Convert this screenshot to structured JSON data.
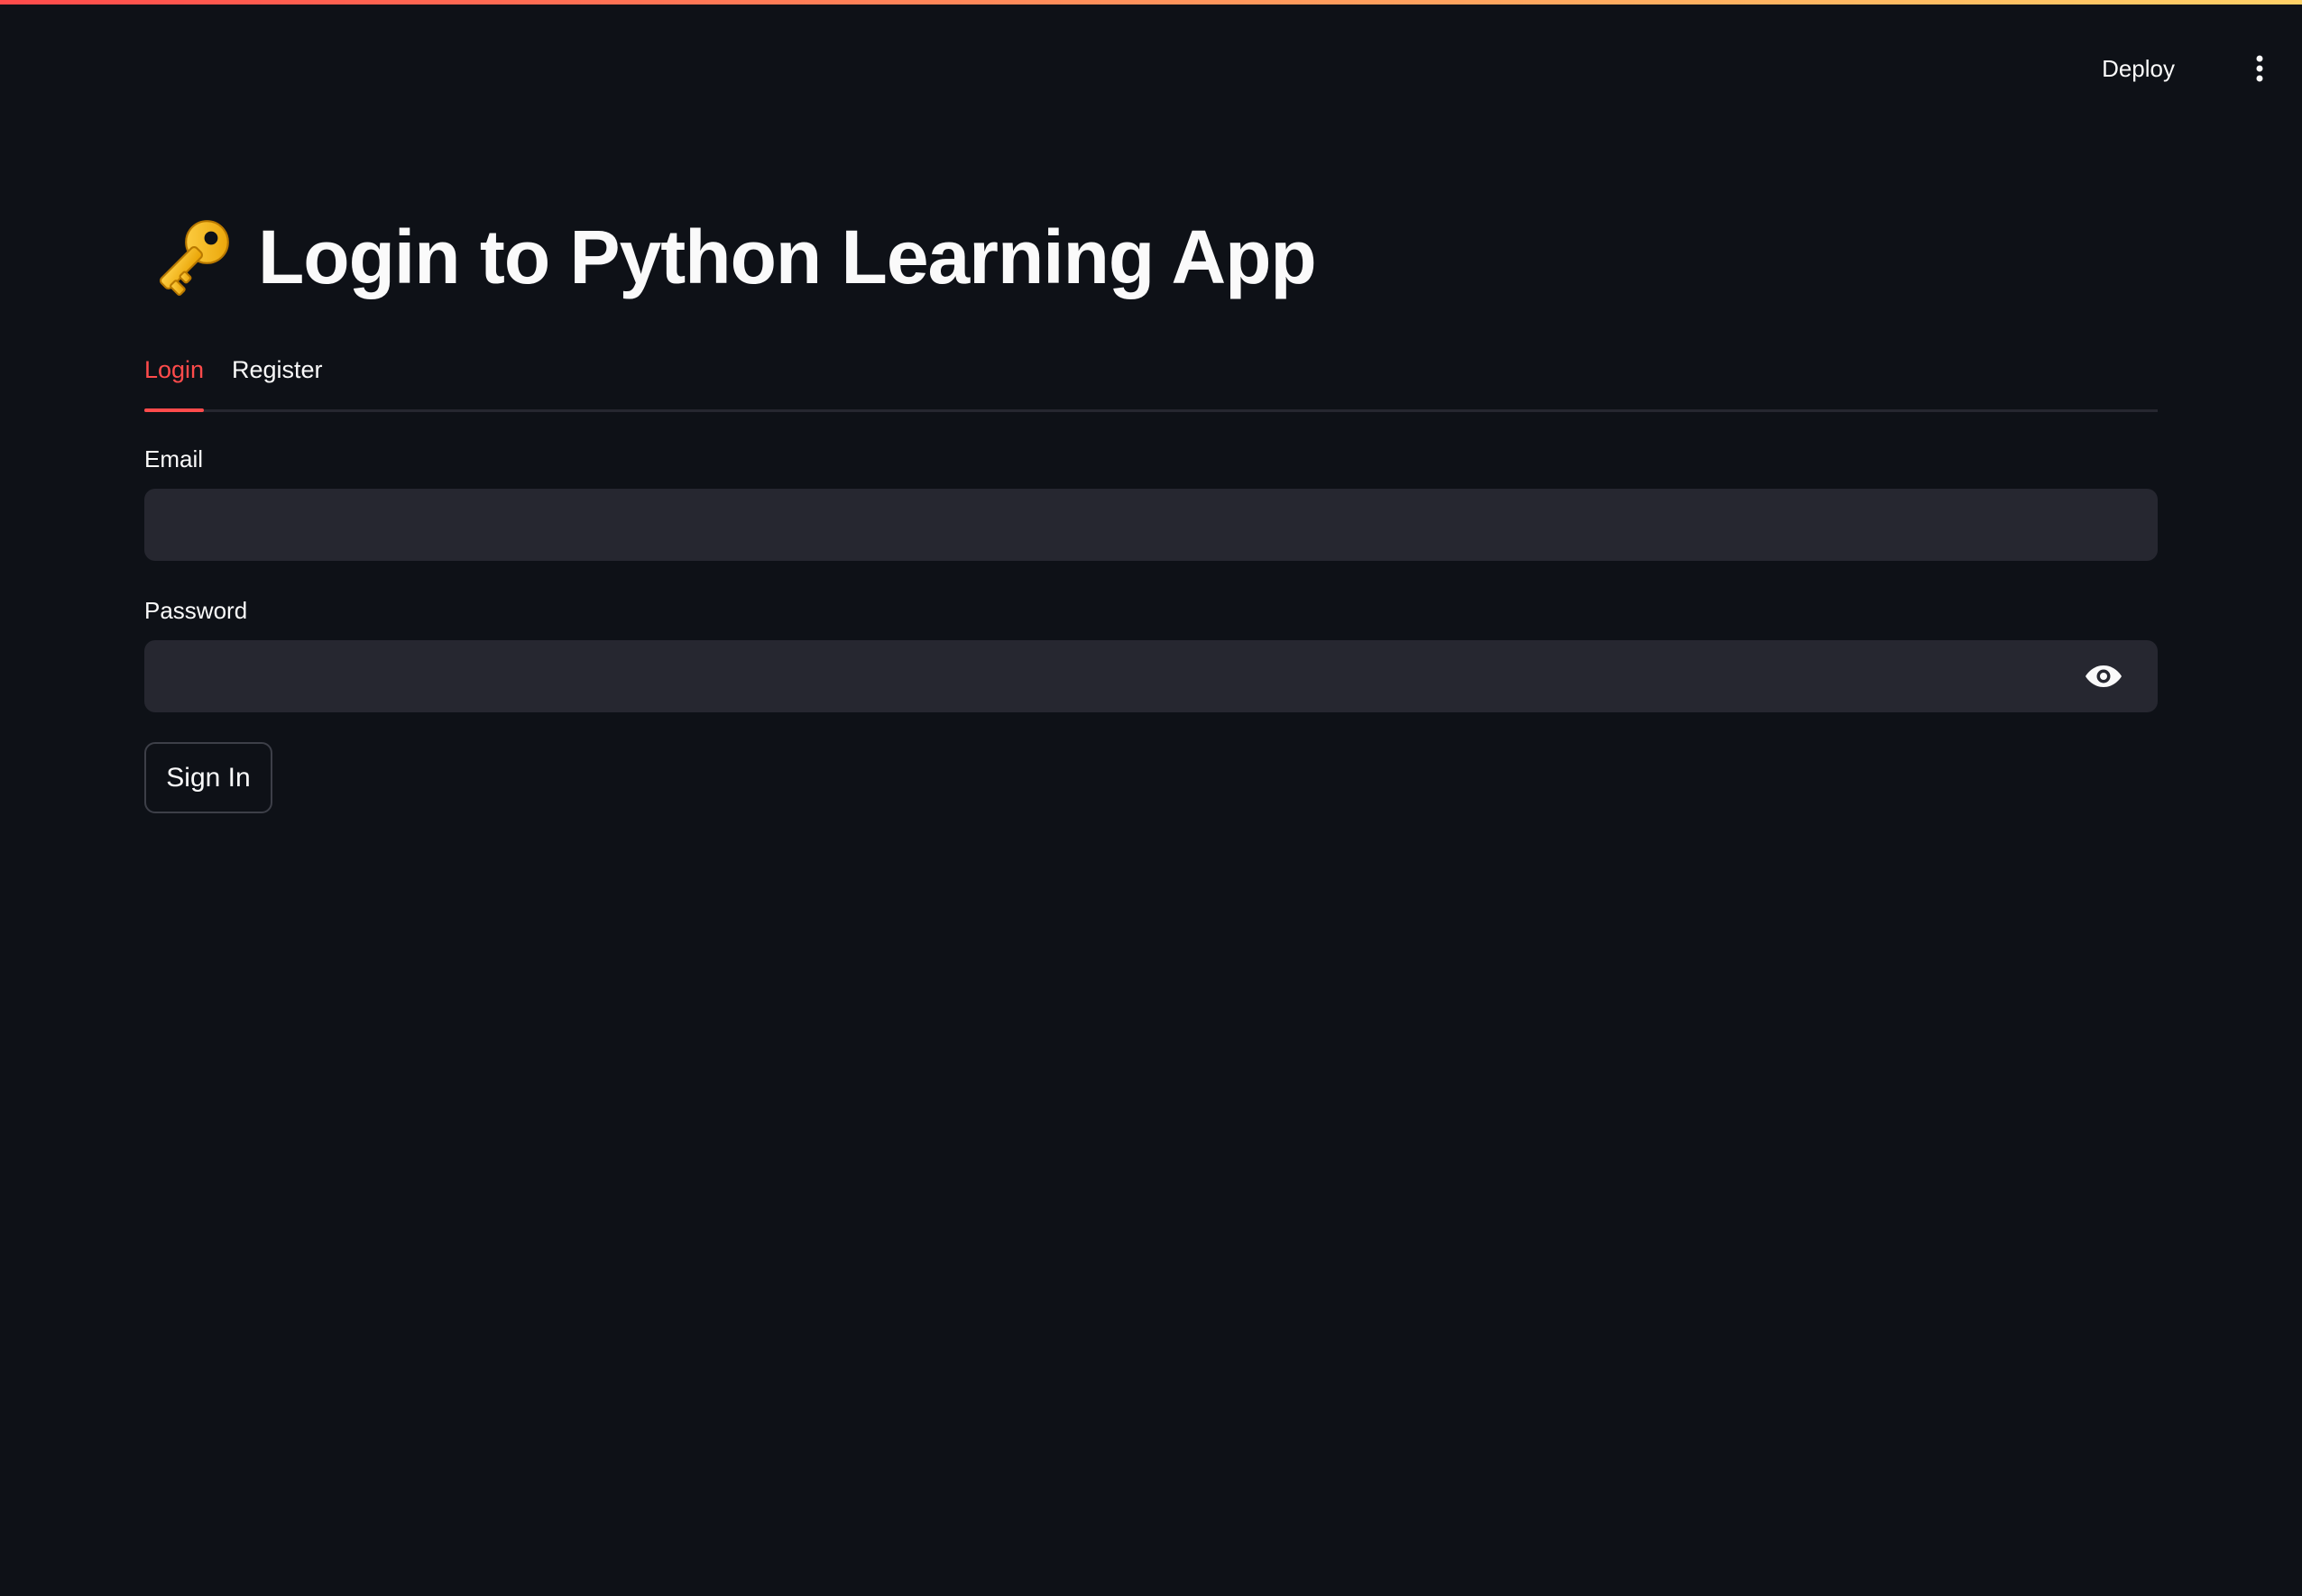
{
  "header": {
    "deploy_label": "Deploy",
    "menu_icon": "kebab-menu-icon"
  },
  "page": {
    "title_icon": "key-icon",
    "title": "Login to Python Learning App"
  },
  "tabs": [
    {
      "label": "Login",
      "active": true
    },
    {
      "label": "Register",
      "active": false
    }
  ],
  "form": {
    "email": {
      "label": "Email",
      "value": "",
      "placeholder": ""
    },
    "password": {
      "label": "Password",
      "value": "",
      "placeholder": "",
      "toggle_icon": "eye-icon"
    },
    "submit_label": "Sign In"
  },
  "colors": {
    "background": "#0e1117",
    "accent": "#ff4b4b",
    "input_bg": "#262730",
    "text": "#fafafa"
  }
}
